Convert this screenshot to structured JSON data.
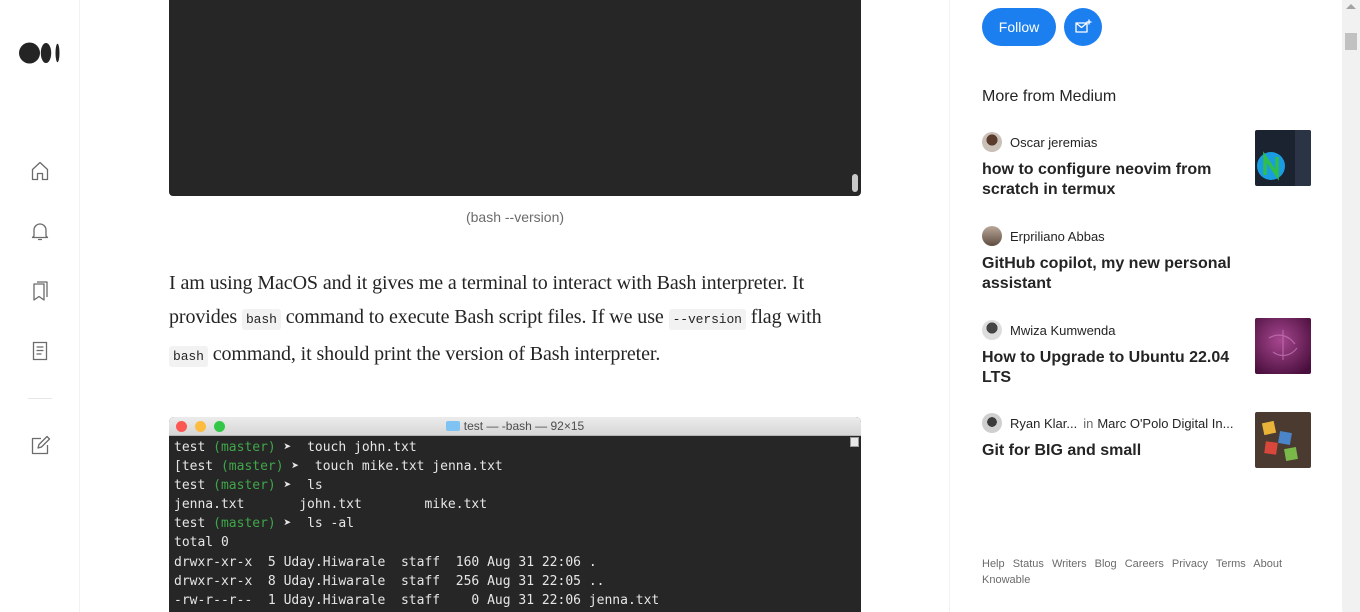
{
  "rail": {
    "icons": [
      "medium-logo",
      "home-icon",
      "bell-icon",
      "bookmarks-icon",
      "stories-icon",
      "write-icon"
    ]
  },
  "article": {
    "caption": "(bash --version)",
    "para_1": "I am using MacOS and it gives me a terminal to interact with Bash interpreter. It provides ",
    "code_1": "bash",
    "para_2": " command to execute Bash script files. If we use ",
    "code_2": "--version",
    "para_3": " flag with ",
    "code_3": "bash",
    "para_4": " command, it should print the version of Bash interpreter.",
    "terminal": {
      "title": "test — -bash — 92×15",
      "lines": [
        {
          "dir": "test",
          "branch": "(master)",
          "cmd": "➤  touch john.txt"
        },
        {
          "dir": "[test",
          "branch": "(master)",
          "cmd": "➤  touch mike.txt jenna.txt"
        },
        {
          "dir": "test",
          "branch": "(master)",
          "cmd": "➤  ls"
        },
        {
          "text": "jenna.txt       john.txt        mike.txt"
        },
        {
          "dir": "test",
          "branch": "(master)",
          "cmd": "➤  ls -al"
        },
        {
          "text": "total 0"
        },
        {
          "text": "drwxr-xr-x  5 Uday.Hiwarale  staff  160 Aug 31 22:06 ."
        },
        {
          "text": "drwxr-xr-x  8 Uday.Hiwarale  staff  256 Aug 31 22:05 .."
        },
        {
          "text": "-rw-r--r--  1 Uday.Hiwarale  staff    0 Aug 31 22:06 jenna.txt"
        }
      ]
    }
  },
  "sidebar": {
    "follow_label": "Follow",
    "subscribe_icon": "mail-plus-icon",
    "more_title": "More from Medium",
    "items": [
      {
        "author": "Oscar jeremias",
        "title": "how to configure neovim from scratch in termux"
      },
      {
        "author": "Erpriliano Abbas",
        "title": "GitHub copilot, my new personal assistant"
      },
      {
        "author": "Mwiza Kumwenda",
        "title": "How to Upgrade to Ubuntu 22.04 LTS"
      },
      {
        "author": "Ryan Klar...",
        "in_label": "in",
        "publication": "Marc O'Polo Digital In...",
        "title": "Git for BIG and small"
      }
    ],
    "footer_links": [
      "Help",
      "Status",
      "Writers",
      "Blog",
      "Careers",
      "Privacy",
      "Terms",
      "About",
      "Knowable"
    ]
  },
  "colors": {
    "accent": "#1b7ff0",
    "terminal_bg": "#262626",
    "git_branch": "#3fa64a"
  }
}
